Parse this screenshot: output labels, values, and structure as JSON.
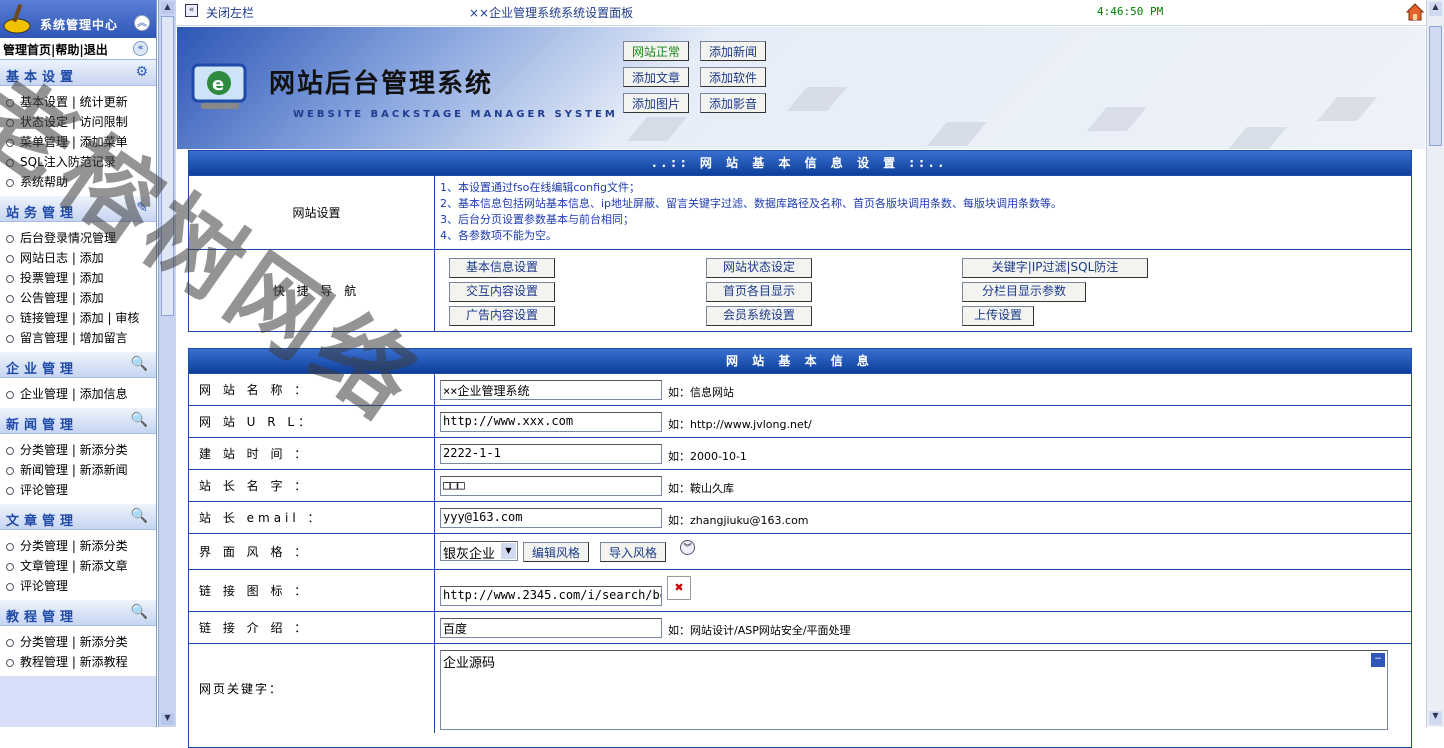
{
  "sidebar": {
    "title": "系统管理中心",
    "links": "管理首页|帮助|退出",
    "groups": [
      {
        "title": "基本设置",
        "items": [
          "基本设置 | 统计更新",
          "状态设定 | 访问限制",
          "菜单管理 | 添加菜单",
          "SQL注入防范记录",
          "系统帮助"
        ]
      },
      {
        "title": "站务管理",
        "items": [
          "后台登录情况管理",
          "网站日志 | 添加",
          "投票管理 | 添加",
          "公告管理 | 添加",
          "链接管理 | 添加 | 审核",
          "留言管理 | 增加留言"
        ]
      },
      {
        "title": "企业管理",
        "items": [
          "企业管理 | 添加信息"
        ]
      },
      {
        "title": "新闻管理",
        "items": [
          "分类管理 | 新添分类",
          "新闻管理 | 新添新闻",
          "评论管理"
        ]
      },
      {
        "title": "文章管理",
        "items": [
          "分类管理 | 新添分类",
          "文章管理 | 新添文章",
          "评论管理"
        ]
      },
      {
        "title": "教程管理",
        "items": [
          "分类管理 | 新添分类",
          "教程管理 | 新添教程"
        ]
      }
    ]
  },
  "topbar": {
    "close_left": "关闭左栏",
    "title": "××企业管理系统系统设置面板",
    "time": "4:46:50 PM"
  },
  "banner": {
    "title": "网站后台管理系统",
    "subtitle": "WEBSITE BACKSTAGE MANAGER SYSTEM"
  },
  "quick_buttons": [
    "网站正常",
    "添加新闻",
    "添加文章",
    "添加软件",
    "添加图片",
    "添加影音"
  ],
  "panel1": {
    "header": "..:: 网 站 基 本 信 息 设 置 ::..",
    "row1_label": "网站设置",
    "notes": [
      "1、本设置通过fso在线编辑config文件；",
      "2、基本信息包括网站基本信息、ip地址屏蔽、留言关键字过滤、数据库路径及名称、首页各版块调用条数、每版块调用条数等。",
      "3、后台分页设置参数基本与前台相同；",
      "4、各参数项不能为空。"
    ],
    "row2_label": "快 捷 导 航",
    "nav_buttons": [
      "基本信息设置",
      "网站状态设定",
      "关键字|IP过滤|SQL防注",
      "交互内容设置",
      "首页各目显示",
      "分栏目显示参数",
      "广告内容设置",
      "会员系统设置",
      "上传设置"
    ]
  },
  "panel2": {
    "header": "网 站 基 本 信 息",
    "rows": [
      {
        "label": "网 站 名 称 ：",
        "value": "××企业管理系统",
        "hint": "如：信息网站"
      },
      {
        "label": "网 站 U R L：",
        "value": "http://www.xxx.com",
        "hint": "如：http://www.jvlong.net/"
      },
      {
        "label": "建 站 时 间 ：",
        "value": "2222-1-1",
        "hint": "如：2000-10-1"
      },
      {
        "label": "站 长 名 字 ：",
        "value": "□□□",
        "hint": "如：鞍山久库"
      },
      {
        "label": "站 长 email ：",
        "value": "yyy@163.com",
        "hint": "如：zhangjiuku@163.com"
      }
    ],
    "style_label": "界 面 风 格 ：",
    "style_value": "银灰企业",
    "edit_style": "编辑风格",
    "import_style": "导入风格",
    "icon_label": "链 接 图 标 ：",
    "icon_value": "http://www.2345.com/i/search/bd",
    "intro_label": "链 接 介 绍 ：",
    "intro_value": "百度",
    "intro_hint": "如：网站设计/ASP网站安全/平面处理",
    "kw_label": "网页关键字：",
    "kw_value": "企业源码"
  },
  "watermark": "老榕树网络"
}
